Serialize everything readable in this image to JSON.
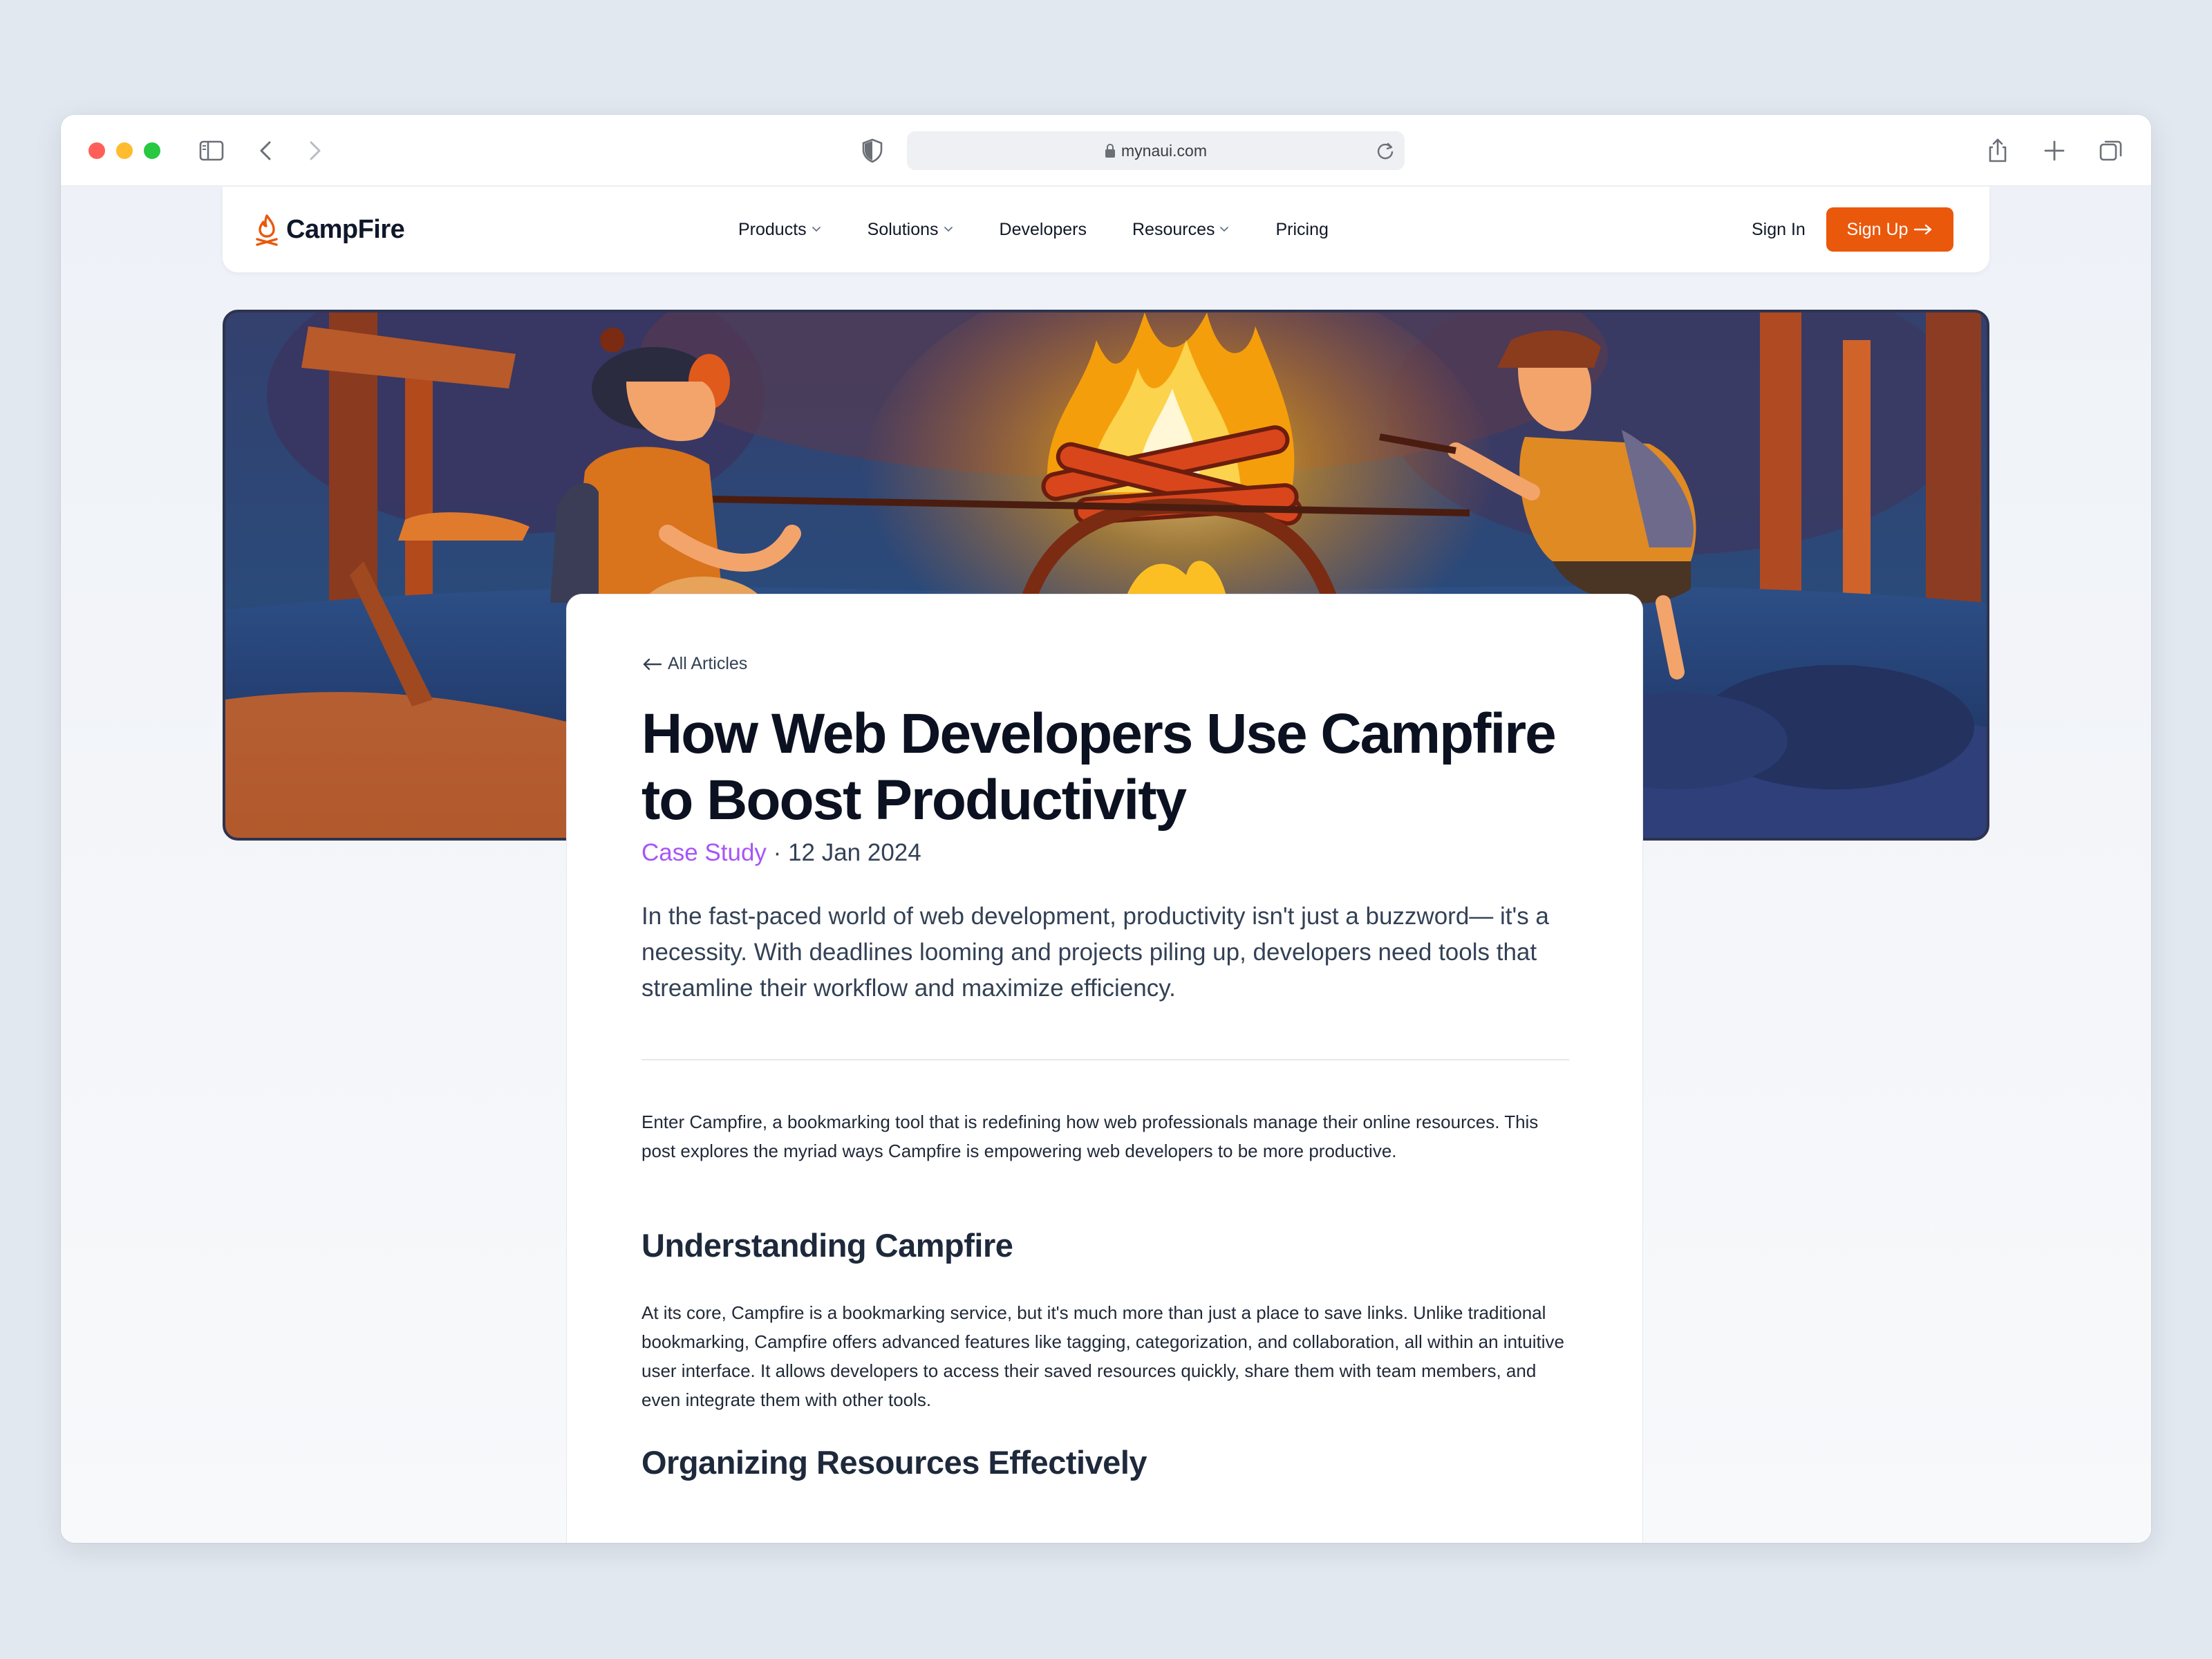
{
  "browser": {
    "url": "mynaui.com"
  },
  "site": {
    "brand": "CampFire",
    "nav": [
      {
        "label": "Products",
        "dropdown": true
      },
      {
        "label": "Solutions",
        "dropdown": true
      },
      {
        "label": "Developers",
        "dropdown": false
      },
      {
        "label": "Resources",
        "dropdown": true
      },
      {
        "label": "Pricing",
        "dropdown": false
      }
    ],
    "signin_label": "Sign In",
    "signup_label": "Sign Up",
    "accent_color": "#ea580c"
  },
  "article": {
    "back_label": "All Articles",
    "title": "How Web Developers Use Campfire to Boost Productivity",
    "category": "Case Study",
    "separator": "·",
    "date": "12 Jan 2024",
    "category_color": "#a855f7",
    "lede": "In the fast-paced world of web development, productivity isn't just a buzzword— it's a necessity. With deadlines looming and projects piling up, developers need tools that streamline their workflow and maximize efficiency.",
    "intro": "Enter Campfire, a bookmarking tool that is redefining how web professionals manage their online resources. This post explores the myriad ways Campfire is empowering web developers to be more productive.",
    "sections": [
      {
        "heading": "Understanding Campfire",
        "body": "At its core, Campfire is a bookmarking service, but it's much more than just a place to save links. Unlike traditional bookmarking, Campfire offers advanced features like tagging, categorization, and collaboration, all within an intuitive user interface. It allows developers to access their saved resources quickly, share them with team members, and even integrate them with other tools."
      },
      {
        "heading": "Organizing Resources Effectively"
      }
    ]
  }
}
